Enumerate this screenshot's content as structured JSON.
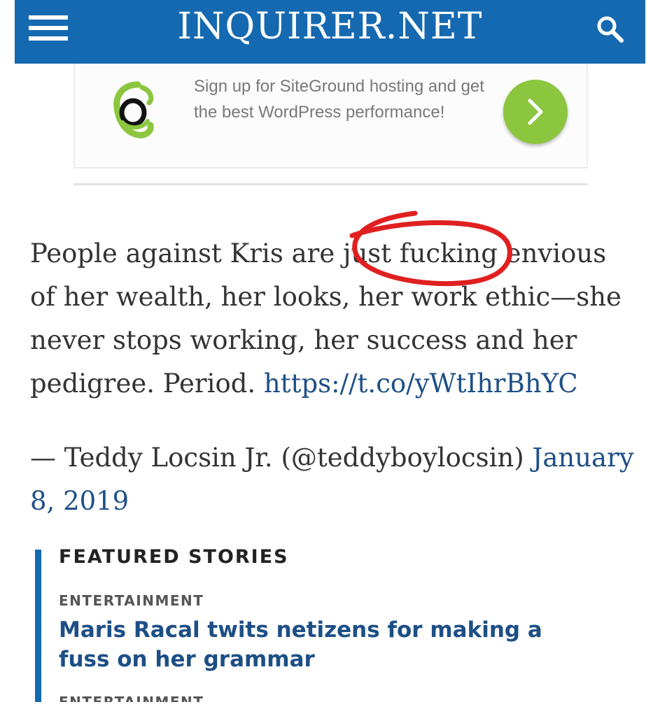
{
  "header": {
    "logo_text": "INQUIRER.NET",
    "background": "#1569b0",
    "menu_icon": "hamburger-menu-icon",
    "search_icon": "search-icon"
  },
  "ad": {
    "text": "Sign up for SiteGround hosting and get the best WordPress performance!",
    "logo_icon": "siteground-logo-icon",
    "arrow_icon": "chevron-right-icon",
    "arrow_color": "#8cc63f"
  },
  "tweet": {
    "text_before_link": "People against Kris are just fucking envious of her wealth, her looks, her work ethic—she never stops working, her success and her pedigree. Period. ",
    "link": "https://t.co/yWtIhrBhYC",
    "attribution": "— Teddy Locsin Jr. (@teddyboylocsin) ",
    "date": "January 8, 2019"
  },
  "featured": {
    "title": "FEATURED STORIES",
    "stories": [
      {
        "category": "ENTERTAINMENT",
        "headline": "Maris Racal twits netizens for making a fuss on her grammar"
      },
      {
        "category": "ENTERTAINMENT",
        "headline": ""
      }
    ]
  }
}
